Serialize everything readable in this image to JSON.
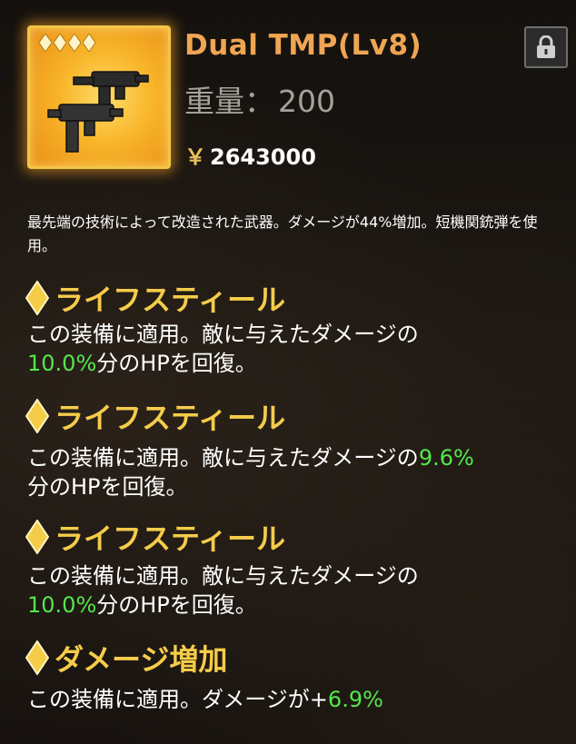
{
  "item": {
    "name": "Dual TMP(Lv8)",
    "weight_label": "重量：",
    "weight_value": "200",
    "price_symbol": "￥",
    "price_value": "2643000",
    "description": "最先端の技術によって改造された武器。ダメージが44%増加。短機関銃弾を使用。",
    "rarity_stars": 4
  },
  "effects": [
    {
      "title": "ライフスティール",
      "text_before": "この装備に適用。敵に与えたダメージの",
      "highlight": "10.0%",
      "text_after": "分のHPを回復。"
    },
    {
      "title": "ライフスティール",
      "text_before": "この装備に適用。敵に与えたダメージの",
      "highlight": "9.6%",
      "text_after": "分のHPを回復。"
    },
    {
      "title": "ライフスティール",
      "text_before": "この装備に適用。敵に与えたダメージの",
      "highlight": "10.0%",
      "text_after": "分のHPを回復。"
    },
    {
      "title": "ダメージ増加",
      "text_before": "この装備に適用。ダメージが+",
      "highlight": "6.9%",
      "text_after": ""
    }
  ],
  "icons": {
    "lock": "lock-icon",
    "weapon": "submachine-gun-icon",
    "bullet": "diamond-bullet-icon"
  },
  "colors": {
    "title": "#f0a552",
    "section_title": "#f5cc4a",
    "highlight": "#55e64c",
    "frame": "#f3c646"
  }
}
